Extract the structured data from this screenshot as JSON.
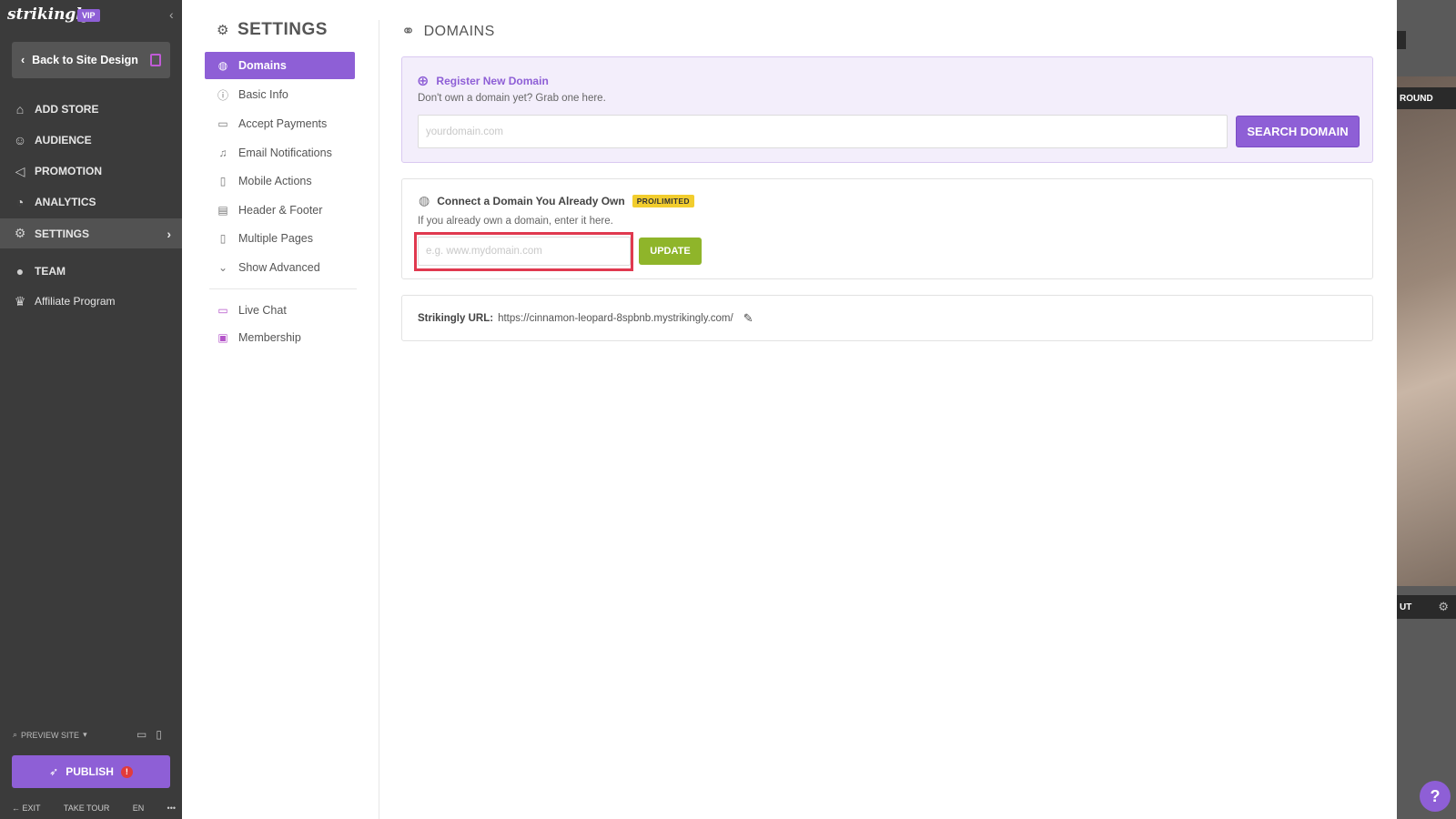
{
  "sidebar": {
    "logo": "strikingly",
    "vip_badge": "VIP",
    "back_label": "Back to Site Design",
    "items": [
      {
        "label": "ADD STORE",
        "icon": "store-icon"
      },
      {
        "label": "AUDIENCE",
        "icon": "audience-icon"
      },
      {
        "label": "PROMOTION",
        "icon": "megaphone-icon"
      },
      {
        "label": "ANALYTICS",
        "icon": "chart-icon"
      },
      {
        "label": "SETTINGS",
        "icon": "gear-icon",
        "active": true
      },
      {
        "label": "TEAM",
        "icon": "team-icon"
      },
      {
        "label": "Affiliate Program",
        "icon": "trophy-icon"
      }
    ],
    "preview_label": "PREVIEW SITE",
    "publish_label": "PUBLISH",
    "publish_alert": "!",
    "bottom": {
      "exit": "EXIT",
      "tour": "TAKE TOUR",
      "lang": "EN",
      "more": "•••"
    }
  },
  "settings_nav": {
    "title": "SETTINGS",
    "items": [
      {
        "label": "Domains",
        "icon": "globe-icon",
        "active": true
      },
      {
        "label": "Basic Info",
        "icon": "info-icon"
      },
      {
        "label": "Accept Payments",
        "icon": "credit-card-icon"
      },
      {
        "label": "Email Notifications",
        "icon": "bell-icon"
      },
      {
        "label": "Mobile Actions",
        "icon": "mobile-icon"
      },
      {
        "label": "Header & Footer",
        "icon": "layout-icon"
      },
      {
        "label": "Multiple Pages",
        "icon": "pages-icon"
      },
      {
        "label": "Show Advanced",
        "icon": "chevron-down-icon"
      },
      {
        "label": "Live Chat",
        "icon": "chat-icon"
      },
      {
        "label": "Membership",
        "icon": "membership-icon"
      }
    ]
  },
  "main": {
    "title": "DOMAINS",
    "register": {
      "title": "Register New Domain",
      "subtitle": "Don't own a domain yet? Grab one here.",
      "placeholder": "yourdomain.com",
      "button": "SEARCH DOMAIN"
    },
    "connect": {
      "title": "Connect a Domain You Already Own",
      "badge": "PRO/LIMITED",
      "subtitle": "If you already own a domain, enter it here.",
      "placeholder": "e.g. www.mydomain.com",
      "button": "UPDATE"
    },
    "strikingly_url": {
      "label": "Strikingly URL:",
      "value": "https://cinnamon-leopard-8spbnb.mystrikingly.com/"
    }
  },
  "right_preview": {
    "label_top": "ROUND",
    "label_bottom": "UT"
  },
  "help_label": "?",
  "colors": {
    "accent": "#8e5fd6",
    "update_green": "#8fb52a",
    "badge_yellow": "#f2cd2e",
    "highlight_red": "#e0394f"
  }
}
